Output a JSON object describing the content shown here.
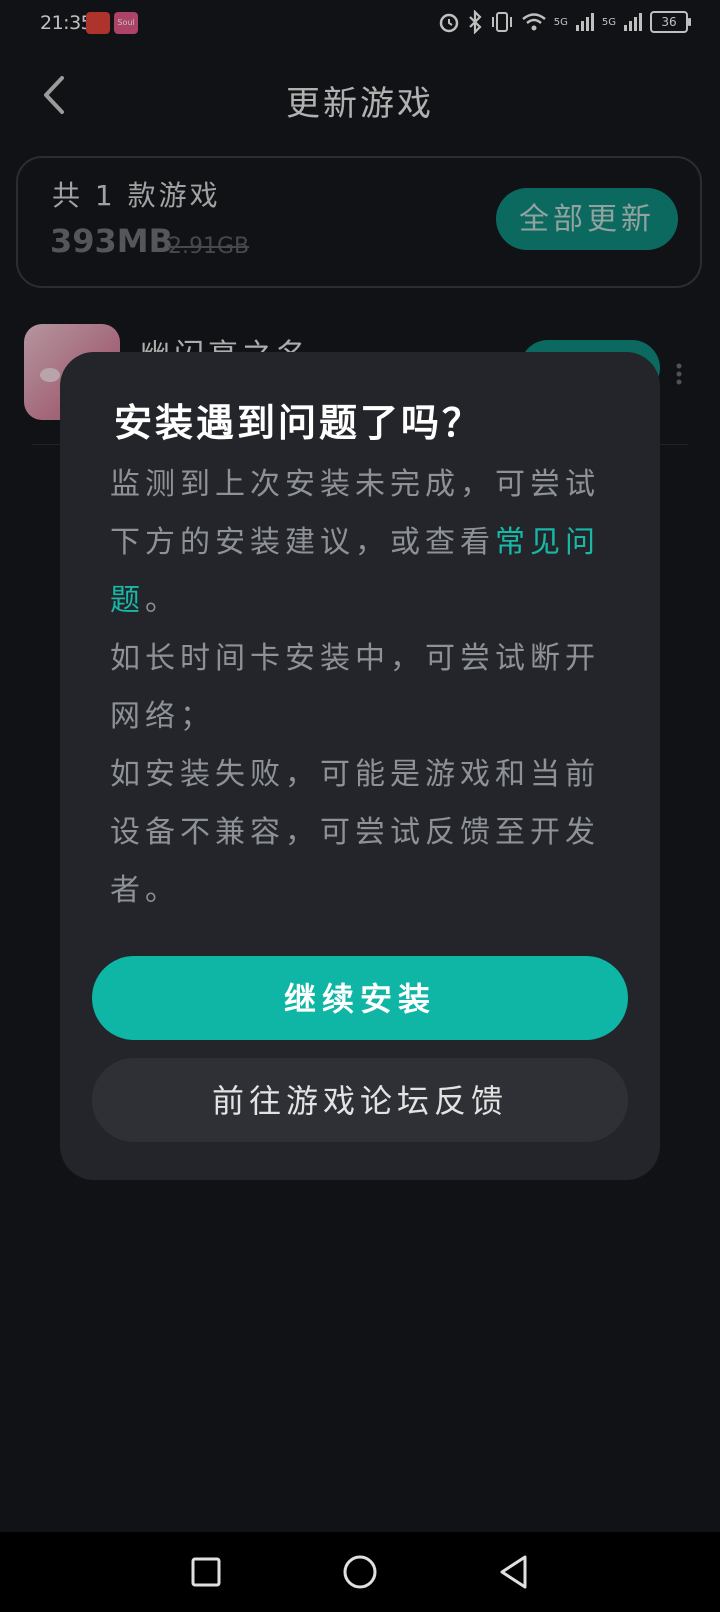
{
  "status_bar": {
    "time": "21:35",
    "app_badge_text": "Soul",
    "network_label_1": "5G",
    "network_label_2": "5G",
    "battery": "36"
  },
  "header": {
    "title": "更新游戏"
  },
  "summary": {
    "count_text": "共 1 款游戏",
    "size": "393MB",
    "old_size": "2.91GB",
    "update_all_label": "全部更新"
  },
  "game_row": {
    "name": "幽闪亮之名"
  },
  "dialog": {
    "title": "安装遇到问题了吗？",
    "paragraph1_text": "监测到上次安装未完成，可尝试下方的安装建议，或查看",
    "paragraph1_link": "常见问题",
    "paragraph1_end": "。",
    "paragraph2": "如长时间卡安装中，可尝试断开网络；",
    "paragraph3": "如安装失败，可能是游戏和当前设备不兼容，可尝试反馈至开发者。",
    "continue_label": "继续安装",
    "forum_label": "前往游戏论坛反馈",
    "accent_color": "#0fb5a5"
  },
  "nav": {
    "icons": [
      "recent-apps-icon",
      "home-icon",
      "back-icon"
    ]
  }
}
